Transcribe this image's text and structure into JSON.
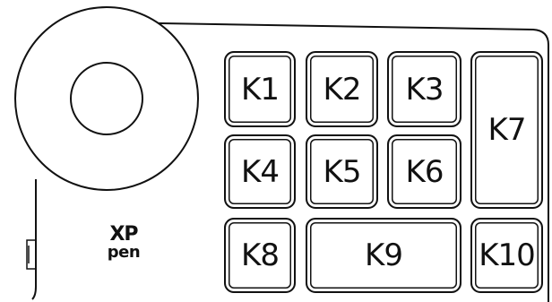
{
  "device": {
    "brand_logo": {
      "line1": "XP",
      "line2": "pen"
    },
    "dial": {
      "icon": "dial-ring"
    },
    "keys": {
      "k1": "K1",
      "k2": "K2",
      "k3": "K3",
      "k4": "K4",
      "k5": "K5",
      "k6": "K6",
      "k7": "K7",
      "k8": "K8",
      "k9": "K9",
      "k10": "K10"
    }
  },
  "colors": {
    "outline": "#111111",
    "background": "#ffffff"
  }
}
